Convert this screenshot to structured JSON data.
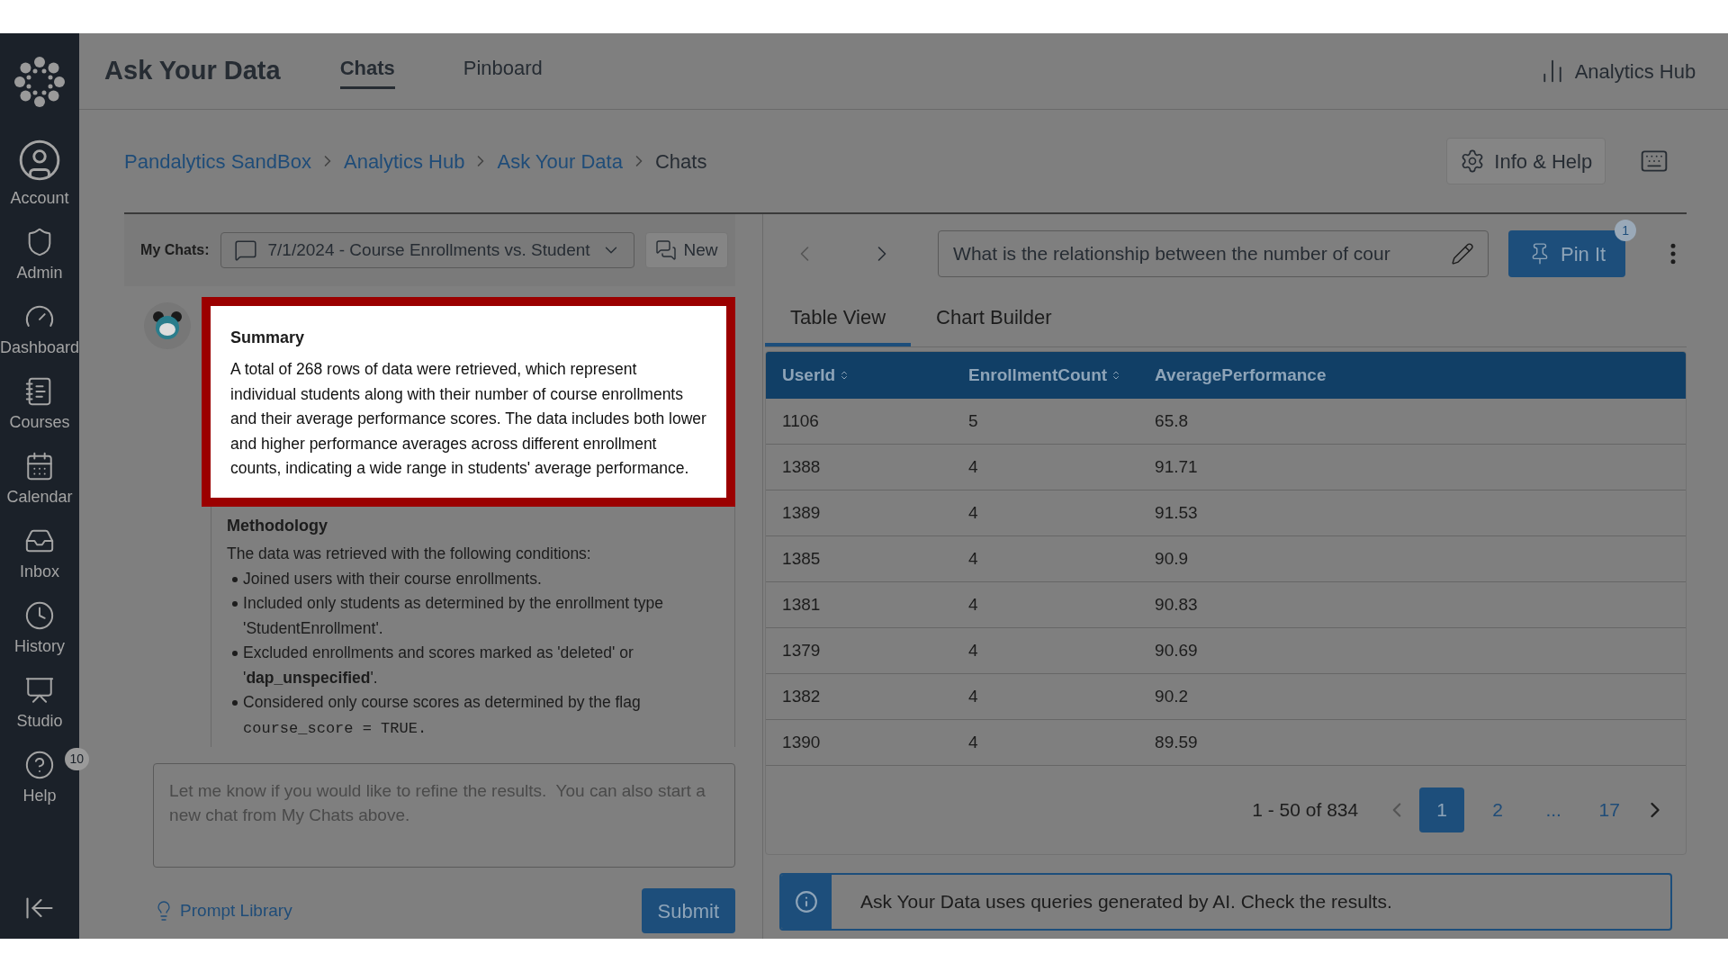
{
  "sidebar": {
    "items": [
      {
        "label": "Account"
      },
      {
        "label": "Admin"
      },
      {
        "label": "Dashboard"
      },
      {
        "label": "Courses"
      },
      {
        "label": "Calendar"
      },
      {
        "label": "Inbox"
      },
      {
        "label": "History"
      },
      {
        "label": "Studio"
      },
      {
        "label": "Help",
        "badge": "10"
      }
    ]
  },
  "header": {
    "title": "Ask Your Data",
    "tabs": [
      {
        "label": "Chats",
        "selected": true
      },
      {
        "label": "Pinboard",
        "selected": false
      }
    ],
    "hub_link": "Analytics Hub"
  },
  "breadcrumb": [
    {
      "label": "Pandalytics SandBox",
      "kind": "link"
    },
    {
      "label": "Analytics Hub",
      "kind": "link"
    },
    {
      "label": "Ask Your Data",
      "kind": "link"
    },
    {
      "label": "Chats",
      "kind": "current"
    }
  ],
  "info_help": "Info & Help",
  "my_chats": {
    "label": "My Chats:",
    "selected_chat": "7/1/2024 - Course Enrollments vs. Student",
    "new_button": "New"
  },
  "summary": {
    "heading": "Summary",
    "text": "A total of 268 rows of data were retrieved, which represent individual students along with their number of course enrollments and their average performance scores. The data includes both lower and higher performance averages across different enrollment counts, indicating a wide range in students' average performance."
  },
  "methodology": {
    "heading": "Methodology",
    "intro": "The data was retrieved with the following conditions:",
    "bullets": [
      {
        "text": "Joined users with their course enrollments."
      },
      {
        "text": "Included only students as determined by the enrollment type 'StudentEnrollment'."
      },
      {
        "text": "Excluded enrollments and scores marked as 'deleted' or '**dap_unspecified**'."
      },
      {
        "text": "Considered only course scores as determined by the flag",
        "code": "course_score = TRUE."
      }
    ]
  },
  "prompt": {
    "placeholder": "Let me know if you would like to refine the results.  You can also start a new chat from My Chats above.",
    "library": "Prompt Library",
    "submit": "Submit"
  },
  "query": {
    "value": "What is the relationship between the number of cour",
    "pin_button": "Pin It",
    "pin_badge": "1"
  },
  "view_tabs": [
    {
      "label": "Table View",
      "selected": true
    },
    {
      "label": "Chart Builder",
      "selected": false
    }
  ],
  "table": {
    "columns": [
      "UserId",
      "EnrollmentCount",
      "AveragePerformance"
    ],
    "rows": [
      [
        "1106",
        "5",
        "65.8"
      ],
      [
        "1388",
        "4",
        "91.71"
      ],
      [
        "1389",
        "4",
        "91.53"
      ],
      [
        "1385",
        "4",
        "90.9"
      ],
      [
        "1381",
        "4",
        "90.83"
      ],
      [
        "1379",
        "4",
        "90.69"
      ],
      [
        "1382",
        "4",
        "90.2"
      ],
      [
        "1390",
        "4",
        "89.59"
      ]
    ]
  },
  "pagination": {
    "range": "1 - 50 of 834",
    "pages": [
      {
        "label": "1",
        "selected": true
      },
      {
        "label": "2",
        "selected": false
      },
      {
        "label": "...",
        "selected": false
      },
      {
        "label": "17",
        "selected": false
      }
    ]
  },
  "notice": "Ask Your Data uses queries generated by AI. Check the results."
}
